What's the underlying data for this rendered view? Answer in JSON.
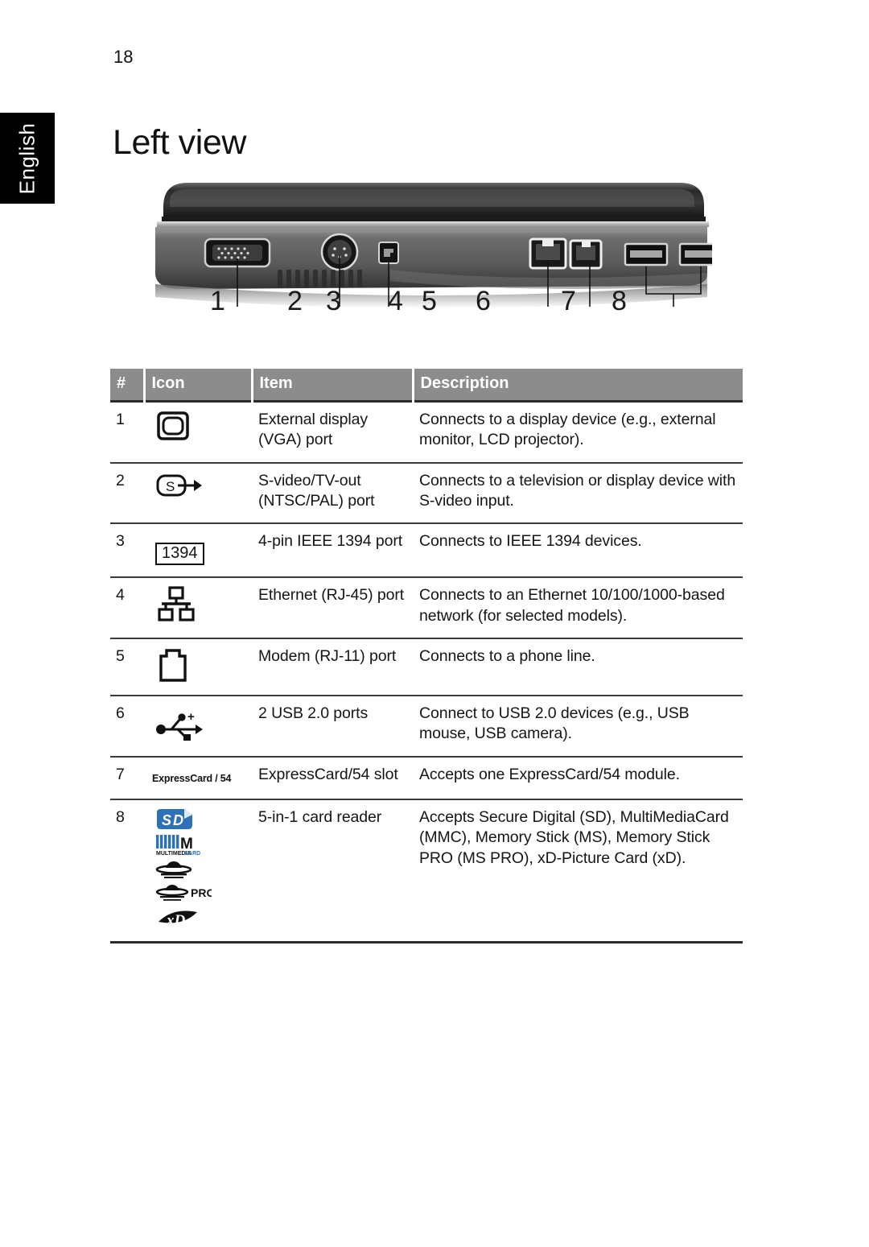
{
  "page": {
    "number": "18",
    "title": "Left view",
    "language_tab": "English"
  },
  "figure": {
    "name": "laptop-left-side-photo",
    "callouts": [
      "1",
      "2",
      "3",
      "4",
      "5",
      "6",
      "7",
      "8"
    ]
  },
  "table": {
    "headers": {
      "num": "#",
      "icon": "Icon",
      "item": "Item",
      "description": "Description"
    },
    "rows": [
      {
        "num": "1",
        "icon_name": "vga-display-icon",
        "icon_text": "",
        "item": "External display (VGA) port",
        "description": "Connects to a display device (e.g., external monitor, LCD projector)."
      },
      {
        "num": "2",
        "icon_name": "s-video-out-icon",
        "icon_text": "S",
        "item": "S-video/TV-out (NTSC/PAL) port",
        "description": "Connects to a television or display device with S-video input."
      },
      {
        "num": "3",
        "icon_name": "ieee-1394-icon",
        "icon_text": "1394",
        "item": "4-pin IEEE 1394 port",
        "description": "Connects to IEEE 1394 devices."
      },
      {
        "num": "4",
        "icon_name": "ethernet-rj45-icon",
        "icon_text": "",
        "item": "Ethernet (RJ-45) port",
        "description": "Connects to an Ethernet 10/100/1000-based network (for selected models)."
      },
      {
        "num": "5",
        "icon_name": "modem-rj11-icon",
        "icon_text": "",
        "item": "Modem (RJ-11) port",
        "description": "Connects to a phone line."
      },
      {
        "num": "6",
        "icon_name": "usb-icon",
        "icon_text": "",
        "item": "2 USB 2.0 ports",
        "description": "Connect to USB 2.0 devices (e.g., USB mouse, USB camera)."
      },
      {
        "num": "7",
        "icon_name": "expresscard-54-icon",
        "icon_text": "ExpressCard / 54",
        "item": "ExpressCard/54 slot",
        "description": "Accepts one ExpressCard/54 module."
      },
      {
        "num": "8",
        "icon_name": "card-reader-logos",
        "icon_text": "",
        "icon_logos": [
          "SD",
          "MultiMediaCard",
          "Memory Stick",
          "Memory Stick PRO",
          "xD"
        ],
        "item": "5-in-1 card reader",
        "description": "Accepts Secure Digital (SD), MultiMediaCard (MMC), Memory Stick (MS), Memory Stick PRO (MS PRO), xD-Picture Card (xD)."
      }
    ]
  },
  "colors": {
    "header_background": "#8c8c8c",
    "rule": "#2b2b2b",
    "tab_background": "#000000",
    "sd_logo_blue": "#2d72b8",
    "text": "#151515"
  }
}
